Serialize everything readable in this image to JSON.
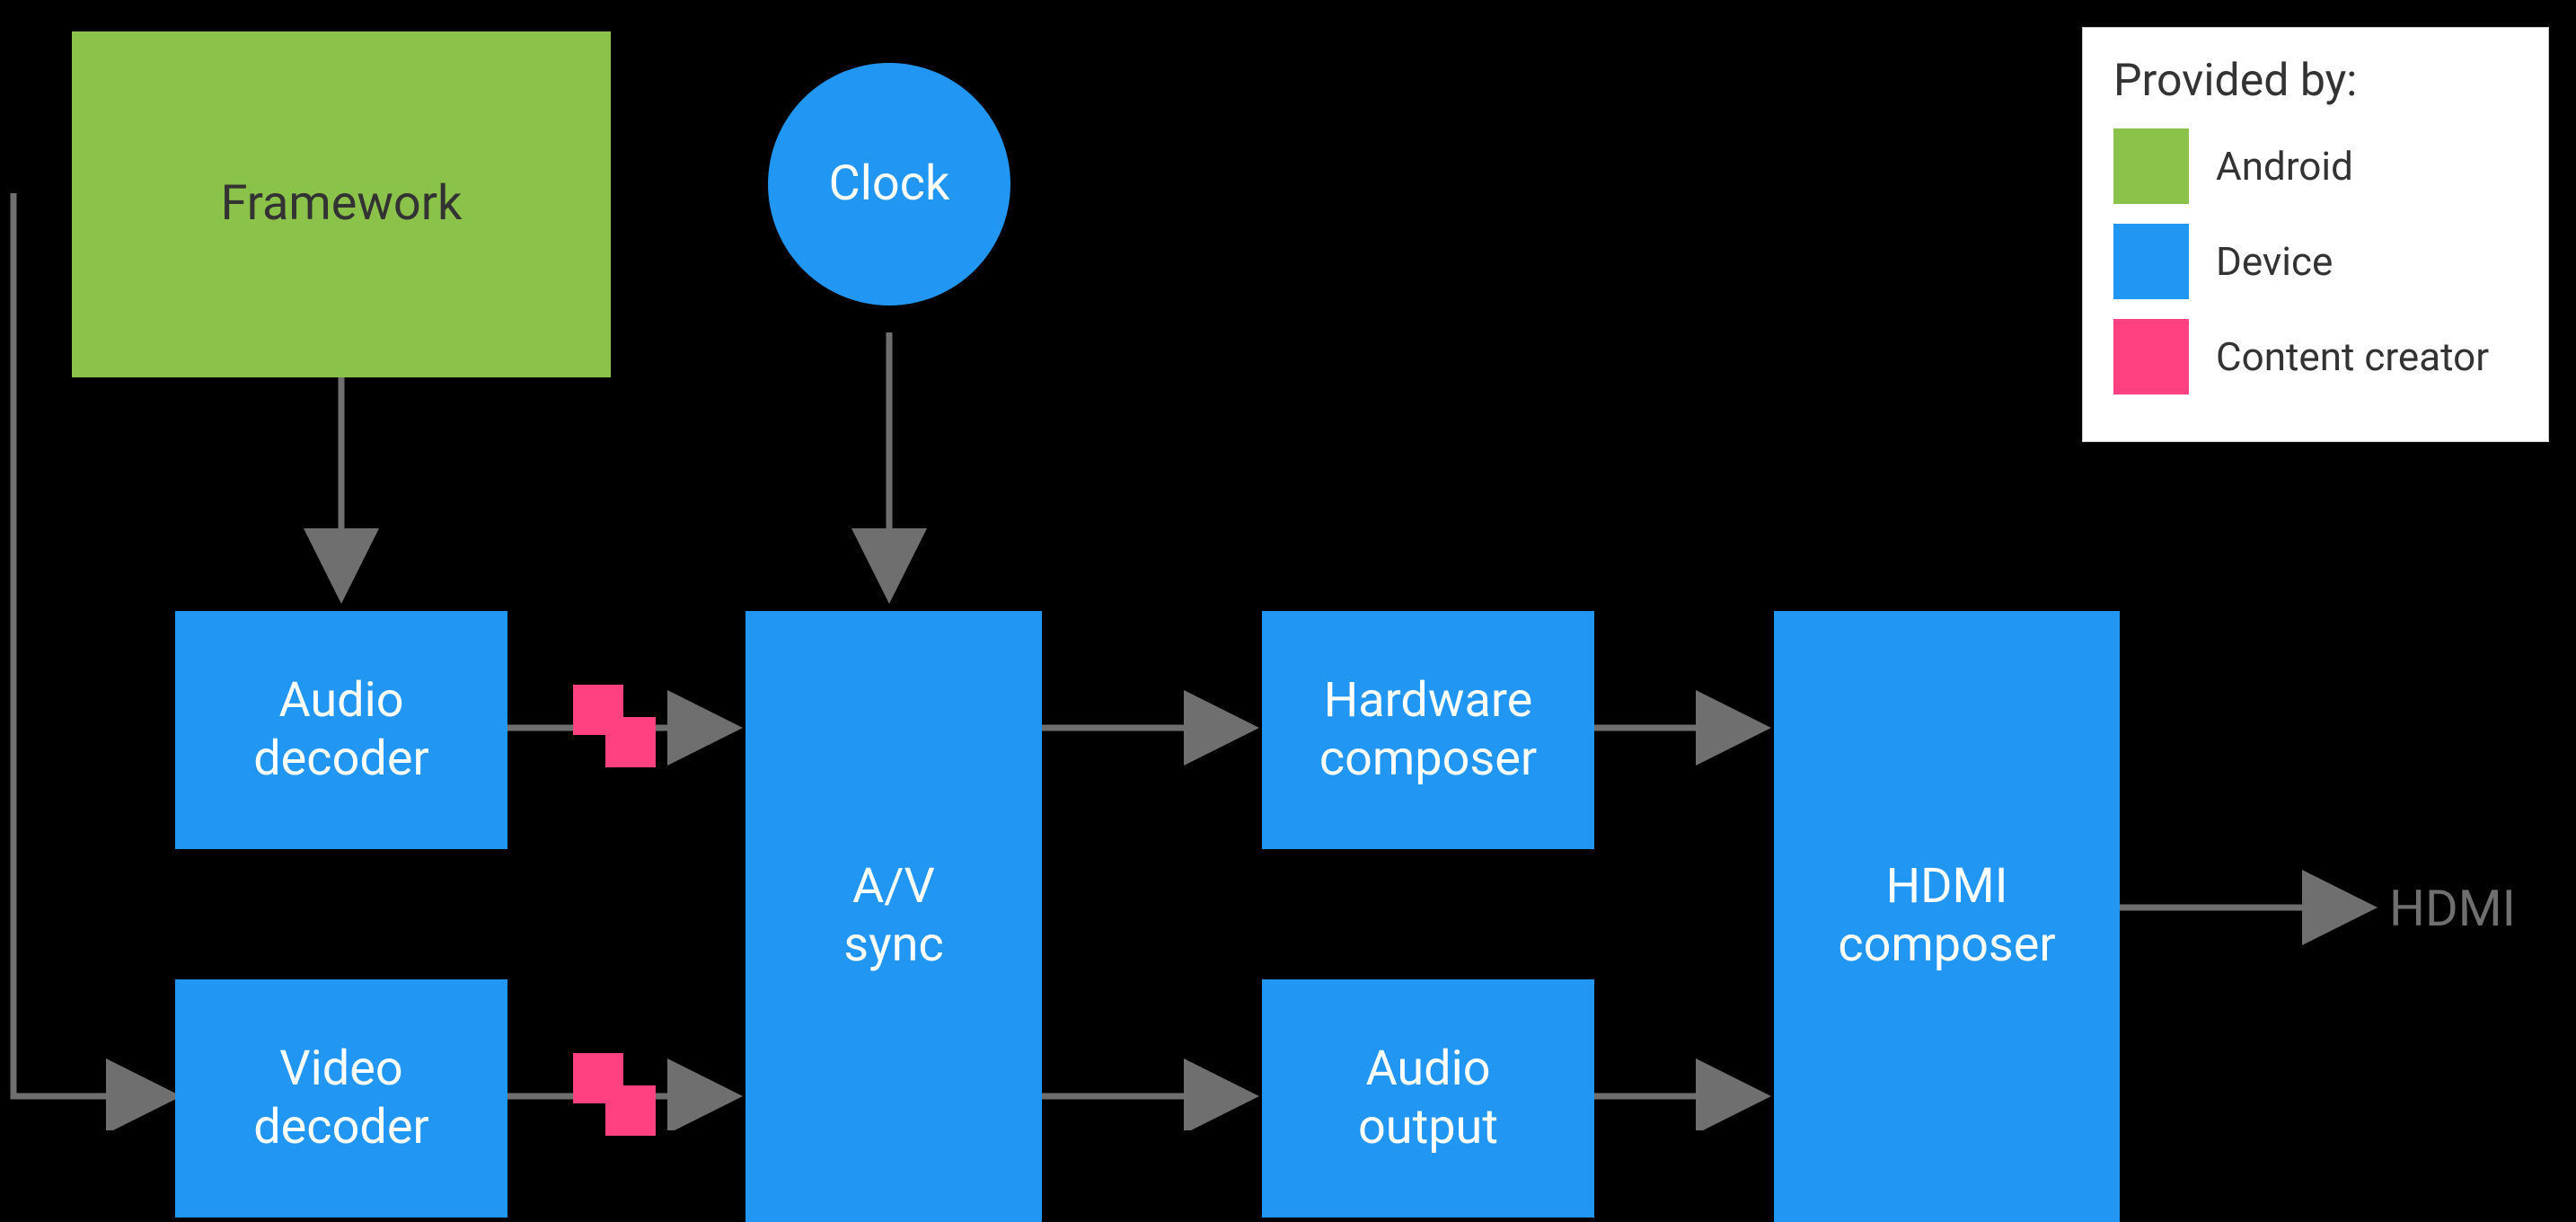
{
  "colors": {
    "green": "#8bc34a",
    "blue": "#2196f3",
    "pink": "#ff4081"
  },
  "nodes": {
    "framework": "Framework",
    "clock": "Clock",
    "audio_decoder": "Audio\ndecoder",
    "video_decoder": "Video\ndecoder",
    "av_sync": "A/V\nsync",
    "hw_composer": "Hardware\ncomposer",
    "audio_output": "Audio\noutput",
    "hdmi_composer": "HDMI\ncomposer"
  },
  "output_label": "HDMI",
  "legend": {
    "title": "Provided by:",
    "items": [
      {
        "label": "Android",
        "role": "android",
        "color": "green"
      },
      {
        "label": "Device",
        "role": "device",
        "color": "blue"
      },
      {
        "label": "Content creator",
        "role": "content-creator",
        "color": "pink"
      }
    ]
  },
  "connectors": [
    {
      "from": "framework",
      "to": "audio_decoder",
      "type": "arrow"
    },
    {
      "from": "clock",
      "to": "av_sync",
      "type": "arrow"
    },
    {
      "from": "audio_decoder",
      "to": "av_sync",
      "via": "content-creator",
      "type": "arrow"
    },
    {
      "from": "video_decoder",
      "to": "av_sync",
      "via": "content-creator",
      "type": "arrow"
    },
    {
      "from": "av_sync",
      "to": "hw_composer",
      "type": "arrow"
    },
    {
      "from": "av_sync",
      "to": "audio_output",
      "type": "arrow"
    },
    {
      "from": "hw_composer",
      "to": "hdmi_composer",
      "type": "arrow"
    },
    {
      "from": "audio_output",
      "to": "hdmi_composer",
      "type": "arrow"
    },
    {
      "from": "hdmi_composer",
      "to": "HDMI",
      "type": "arrow"
    },
    {
      "from": "external",
      "to": "video_decoder",
      "type": "elbow"
    }
  ]
}
